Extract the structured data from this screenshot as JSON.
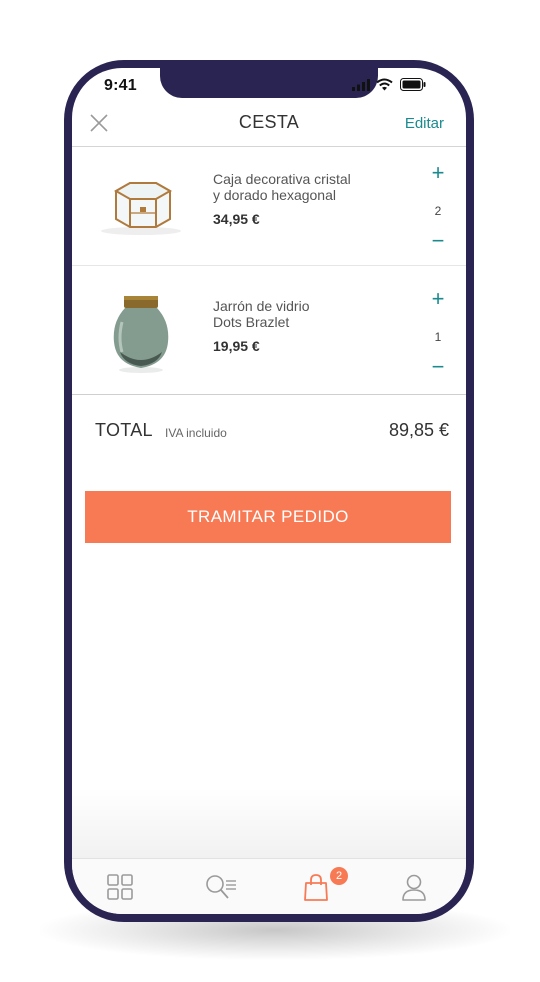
{
  "status_bar": {
    "time": "9:41"
  },
  "header": {
    "title": "CESTA",
    "edit_label": "Editar"
  },
  "cart": {
    "items": [
      {
        "name_line1": "Caja decorativa cristal",
        "name_line2": "y dorado hexagonal",
        "price": "34,95 €",
        "quantity": "2",
        "plus": "+",
        "minus": "−"
      },
      {
        "name_line1": "Jarrón de vidrio",
        "name_line2": "Dots Brazlet",
        "price": "19,95 €",
        "quantity": "1",
        "plus": "+",
        "minus": "−"
      }
    ],
    "total_label": "TOTAL",
    "vat_label": "IVA incluido",
    "total_amount": "89,85 €",
    "checkout_label": "TRAMITAR PEDIDO"
  },
  "tab_bar": {
    "tabs": [
      {
        "icon": "grid-icon",
        "active": false
      },
      {
        "icon": "search-list-icon",
        "active": false
      },
      {
        "icon": "shopping-bag-icon",
        "active": true,
        "badge": "2"
      },
      {
        "icon": "user-icon",
        "active": false
      }
    ]
  },
  "colors": {
    "frame": "#2a2452",
    "accent": "#1a8a8e",
    "cta": "#f87a55",
    "badge": "#f87a55"
  }
}
